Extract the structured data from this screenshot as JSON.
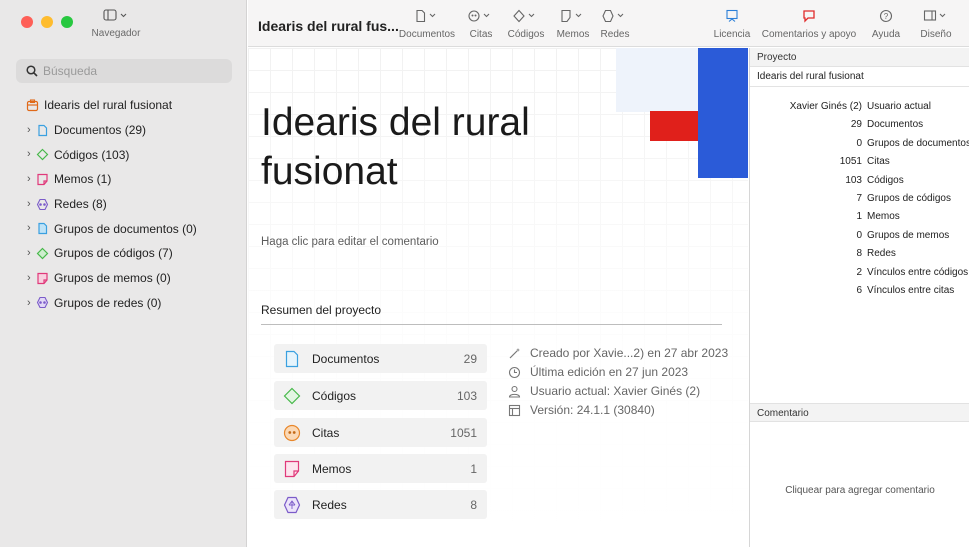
{
  "sidebar": {
    "nav_label": "Navegador",
    "search_placeholder": "Búsqueda",
    "project_item": "Idearis del rural fusionat",
    "items": [
      {
        "label": "Documentos (29)",
        "icon": "document-icon",
        "color": "#3aa0e0"
      },
      {
        "label": "Códigos (103)",
        "icon": "code-diamond-icon",
        "color": "#47b84a"
      },
      {
        "label": "Memos (1)",
        "icon": "memo-icon",
        "color": "#e0397a"
      },
      {
        "label": "Redes (8)",
        "icon": "network-icon",
        "color": "#7b5bc9"
      },
      {
        "label": "Grupos de documentos (0)",
        "icon": "document-group-icon",
        "color": "#3aa0e0"
      },
      {
        "label": "Grupos de códigos (7)",
        "icon": "code-group-icon",
        "color": "#47b84a"
      },
      {
        "label": "Grupos de memos (0)",
        "icon": "memo-group-icon",
        "color": "#e0397a"
      },
      {
        "label": "Grupos de redes (0)",
        "icon": "network-group-icon",
        "color": "#7b5bc9"
      }
    ]
  },
  "toolbar": {
    "title": "Idearis del rural fus...",
    "buttons": [
      {
        "label": "Documentos",
        "icon": "document-icon"
      },
      {
        "label": "Citas",
        "icon": "quote-icon"
      },
      {
        "label": "Códigos",
        "icon": "code-diamond-icon"
      },
      {
        "label": "Memos",
        "icon": "memo-icon"
      },
      {
        "label": "Redes",
        "icon": "network-icon"
      }
    ],
    "right_buttons": [
      {
        "label": "Licencia",
        "icon": "license-icon"
      },
      {
        "label": "Comentarios y apoyo",
        "icon": "feedback-icon"
      },
      {
        "label": "Ayuda",
        "icon": "help-icon"
      },
      {
        "label": "Diseño",
        "icon": "layout-icon"
      }
    ]
  },
  "main": {
    "title": "Idearis del rural fusionat",
    "comment_hint": "Haga clic para editar el comentario",
    "summary_title": "Resumen del proyecto",
    "cards": [
      {
        "label": "Documentos",
        "value": "29"
      },
      {
        "label": "Códigos",
        "value": "103"
      },
      {
        "label": "Citas",
        "value": "1051"
      },
      {
        "label": "Memos",
        "value": "1"
      },
      {
        "label": "Redes",
        "value": "8"
      }
    ],
    "meta": [
      {
        "text": "Creado por Xavie...2) en 27 abr 2023",
        "icon": "magic-wand-icon"
      },
      {
        "text": "Última edición en 27 jun 2023",
        "icon": "clock-icon"
      },
      {
        "text": "Usuario actual: Xavier Ginés (2)",
        "icon": "user-icon"
      },
      {
        "text": "Versión: 24.1.1 (30840)",
        "icon": "version-icon"
      }
    ]
  },
  "inspector": {
    "header": "Proyecto",
    "name": "Idearis del rural fusionat",
    "stats": [
      {
        "n": "Xavier Ginés (2)",
        "t": "Usuario actual"
      },
      {
        "n": "29",
        "t": "Documentos"
      },
      {
        "n": "0",
        "t": "Grupos de documentos"
      },
      {
        "n": "1051",
        "t": "Citas"
      },
      {
        "n": "103",
        "t": "Códigos"
      },
      {
        "n": "7",
        "t": "Grupos de códigos"
      },
      {
        "n": "1",
        "t": "Memos"
      },
      {
        "n": "0",
        "t": "Grupos de memos"
      },
      {
        "n": "8",
        "t": "Redes"
      },
      {
        "n": "2",
        "t": "Vínculos entre códigos"
      },
      {
        "n": "6",
        "t": "Vínculos entre citas"
      }
    ],
    "comment_header": "Comentario",
    "comment_cta": "Cliquear para agregar comentario"
  }
}
